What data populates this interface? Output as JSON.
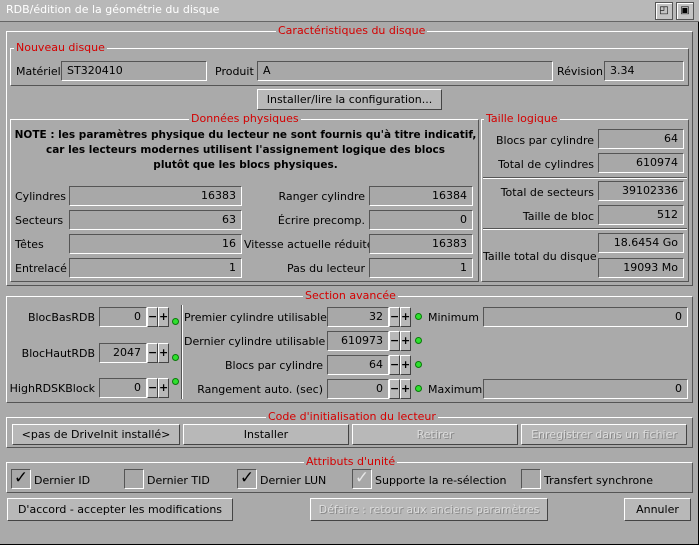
{
  "window": {
    "title": "RDB/édition de la géométrie du disque",
    "buttons": [
      "◰",
      "▣"
    ]
  },
  "characteristics": {
    "title": "Caractéristiques du disque",
    "new_disk": {
      "title": "Nouveau disque",
      "material_label": "Matériel",
      "material_value": "ST320410",
      "product_label": "Produit",
      "product_value": "A",
      "revision_label": "Révision",
      "revision_value": "3.34"
    },
    "install_button": "Installer/lire la configuration...",
    "physical": {
      "title": "Données physiques",
      "note_line1": "NOTE : les paramètres physique du lecteur ne sont fournis qu'à titre indicatif,",
      "note_line2": "car les lecteurs modernes utilisent l'assignement logique des blocs",
      "note_line3": "plutôt que les blocs physiques.",
      "cylinders_label": "Cylindres",
      "cylinders_value": "16383",
      "sectors_label": "Secteurs",
      "sectors_value": "63",
      "heads_label": "Têtes",
      "heads_value": "16",
      "interleave_label": "Entrelacé",
      "interleave_value": "1",
      "park_label": "Ranger cylindre",
      "park_value": "16384",
      "precomp_label": "Écrire precomp.",
      "precomp_value": "0",
      "reduced_label": "Vitesse actuelle réduite",
      "reduced_value": "16383",
      "step_label": "Pas du lecteur",
      "step_value": "1"
    },
    "logical": {
      "title": "Taille logique",
      "bpc_label": "Blocs par cylindre",
      "bpc_value": "64",
      "total_cyl_label": "Total de cylindres",
      "total_cyl_value": "610974",
      "total_sec_label": "Total de secteurs",
      "total_sec_value": "39102336",
      "block_size_label": "Taille de bloc",
      "block_size_value": "512",
      "disk_size_label": "Taille total du disque",
      "disk_size_go": "18.6454 Go",
      "disk_size_mo": "19093 Mo"
    }
  },
  "advanced": {
    "title": "Section avancée",
    "rdb_low_label": "BlocBasRDB",
    "rdb_low_value": "0",
    "rdb_high_label": "BlocHautRDB",
    "rdb_high_value": "2047",
    "highrdsk_label": "HighRDSKBlock",
    "highrdsk_value": "0",
    "first_cyl_label": "Premier cylindre utilisable",
    "first_cyl_value": "32",
    "last_cyl_label": "Dernier cylindre utilisable",
    "last_cyl_value": "610973",
    "bpc_label": "Blocs par cylindre",
    "bpc_value": "64",
    "autopark_label": "Rangement auto. (sec)",
    "autopark_value": "0",
    "minimum_label": "Minimum",
    "minimum_value": "0",
    "maximum_label": "Maximum",
    "maximum_value": "0",
    "minus": "−",
    "plus": "+"
  },
  "init_code": {
    "title": "Code d'initialisation du lecteur",
    "status_button": "<pas de DriveInit installé>",
    "install": "Installer",
    "remove": "Retirer",
    "save": "Enregistrer dans un fichier"
  },
  "attributes": {
    "title": "Attributs d'unité",
    "last_id": {
      "label": "Dernier ID",
      "checked": true
    },
    "last_tid": {
      "label": "Dernier TID",
      "checked": false
    },
    "last_lun": {
      "label": "Dernier LUN",
      "checked": true
    },
    "reselect": {
      "label": "Supporte la re-sélection",
      "checked": true
    },
    "sync": {
      "label": "Transfert synchrone",
      "checked": false
    }
  },
  "footer": {
    "ok": "D'accord - accepter les modifications",
    "revert": "Défaire : retour aux anciens paramètres",
    "cancel": "Annuler"
  },
  "colors": {
    "group_title": "#d40000",
    "led": "#2ee02e",
    "background": "#aaaaaa"
  }
}
